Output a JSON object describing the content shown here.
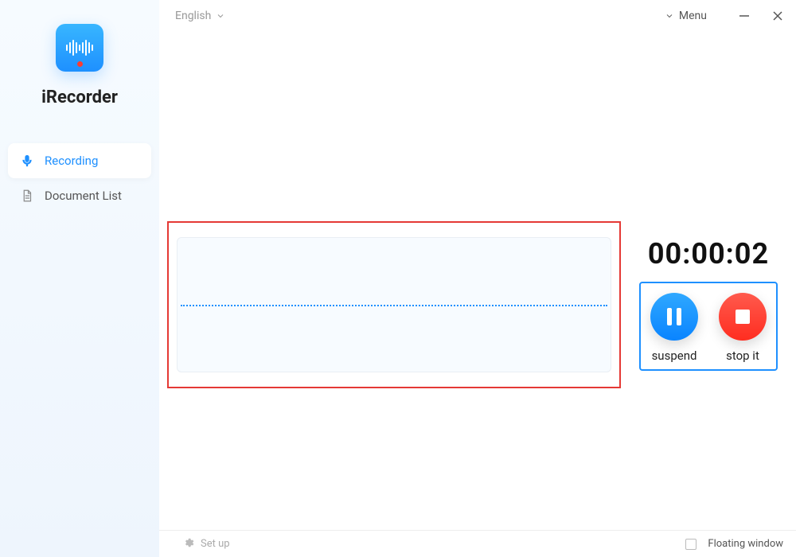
{
  "app": {
    "name": "iRecorder"
  },
  "topbar": {
    "language": "English",
    "menu_label": "Menu"
  },
  "sidebar": {
    "items": [
      {
        "label": "Recording",
        "icon": "mic-icon",
        "active": true
      },
      {
        "label": "Document List",
        "icon": "document-icon",
        "active": false
      }
    ]
  },
  "recording": {
    "timer": "00:00:02",
    "controls": {
      "pause_label": "suspend",
      "stop_label": "stop it"
    }
  },
  "statusbar": {
    "setup_label": "Set up",
    "floating_window_label": "Floating window",
    "floating_window_checked": false
  },
  "colors": {
    "accent": "#1e90ff",
    "danger": "#ff3b30",
    "highlight_border": "#e53935"
  }
}
